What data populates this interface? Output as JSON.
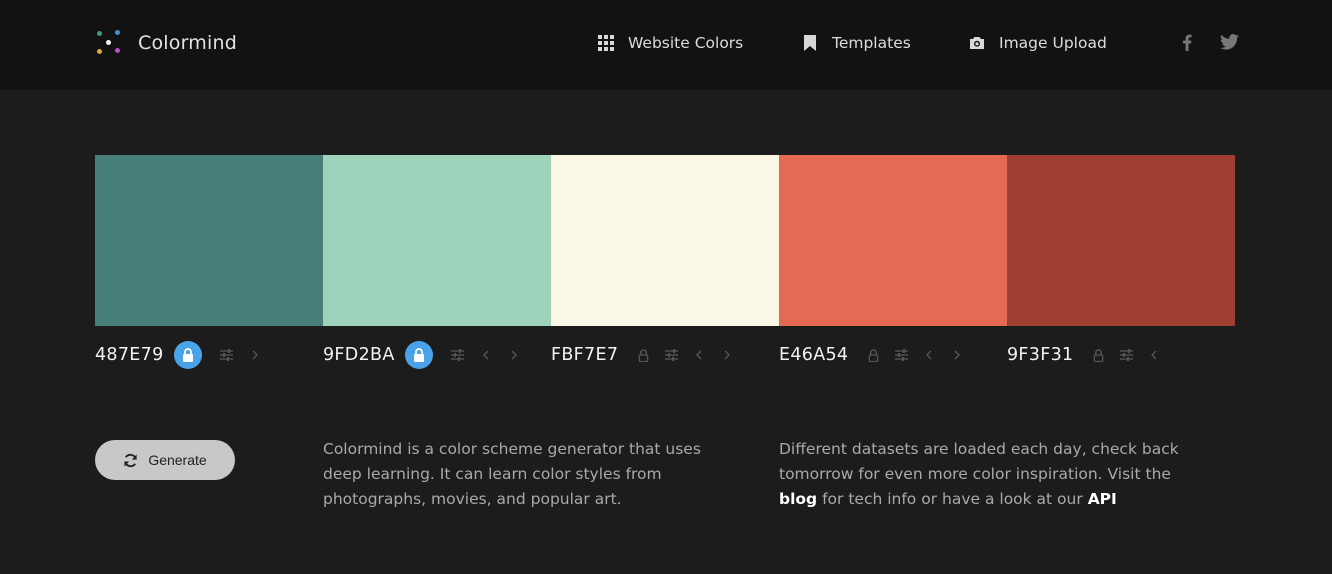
{
  "header": {
    "brand": "Colormind",
    "nav": [
      {
        "label": "Website Colors",
        "icon": "grid-icon"
      },
      {
        "label": "Templates",
        "icon": "bookmark-icon"
      },
      {
        "label": "Image Upload",
        "icon": "camera-icon"
      }
    ],
    "social": [
      {
        "icon": "facebook-icon"
      },
      {
        "icon": "twitter-icon"
      }
    ]
  },
  "palette": [
    {
      "hex": "487E79",
      "color": "#487E79",
      "locked": true
    },
    {
      "hex": "9FD2BA",
      "color": "#9FD2BA",
      "locked": true
    },
    {
      "hex": "FBF7E7",
      "color": "#FBF7E7",
      "locked": false
    },
    {
      "hex": "E46A54",
      "color": "#E46A54",
      "locked": false
    },
    {
      "hex": "9F3F31",
      "color": "#9F3F31",
      "locked": false
    }
  ],
  "generate": {
    "label": "Generate",
    "icon": "refresh-icon"
  },
  "about": {
    "text": "Colormind is a color scheme generator that uses deep learning. It can learn color styles from photographs, movies, and popular art."
  },
  "datasets": {
    "text_before": "Different datasets are loaded each day, check back tomorrow for even more color inspiration. Visit the",
    "blog_link": "blog",
    "text_middle": "for tech info or have a look at our",
    "api_link": "API"
  },
  "colors": {
    "accent": "#4aa3e8",
    "background": "#1c1c1c",
    "header_bg": "#121212"
  }
}
